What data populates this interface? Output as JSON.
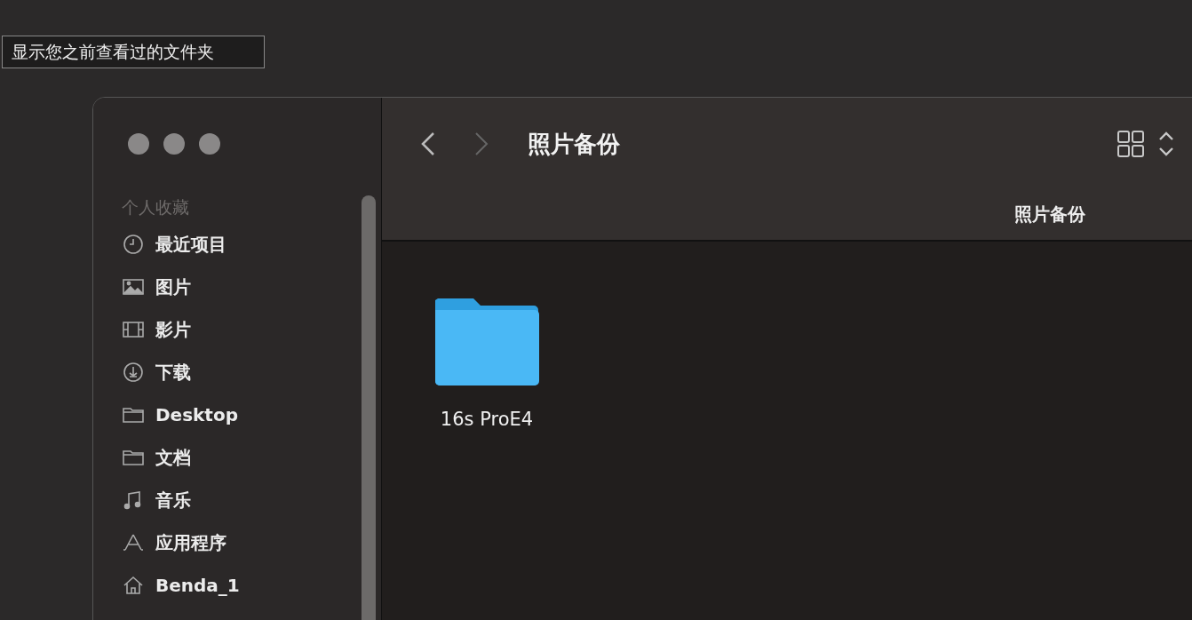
{
  "tooltip": {
    "text": "显示您之前查看过的文件夹"
  },
  "window": {
    "title": "照片备份",
    "path_label": "照片备份"
  },
  "toolbar": {
    "back": {
      "disabled": false
    },
    "forward": {
      "disabled": true
    }
  },
  "sidebar": {
    "section": "个人收藏",
    "items": [
      {
        "kind": "recent",
        "label": "最近项目"
      },
      {
        "kind": "pictures",
        "label": "图片"
      },
      {
        "kind": "movies",
        "label": "影片"
      },
      {
        "kind": "downloads",
        "label": "下载"
      },
      {
        "kind": "folder",
        "label": "Desktop"
      },
      {
        "kind": "folder",
        "label": "文档"
      },
      {
        "kind": "music",
        "label": "音乐"
      },
      {
        "kind": "apps",
        "label": "应用程序"
      },
      {
        "kind": "home",
        "label": "Benda_1"
      }
    ]
  },
  "files": [
    {
      "kind": "folder",
      "name": "16s ProE4"
    }
  ]
}
